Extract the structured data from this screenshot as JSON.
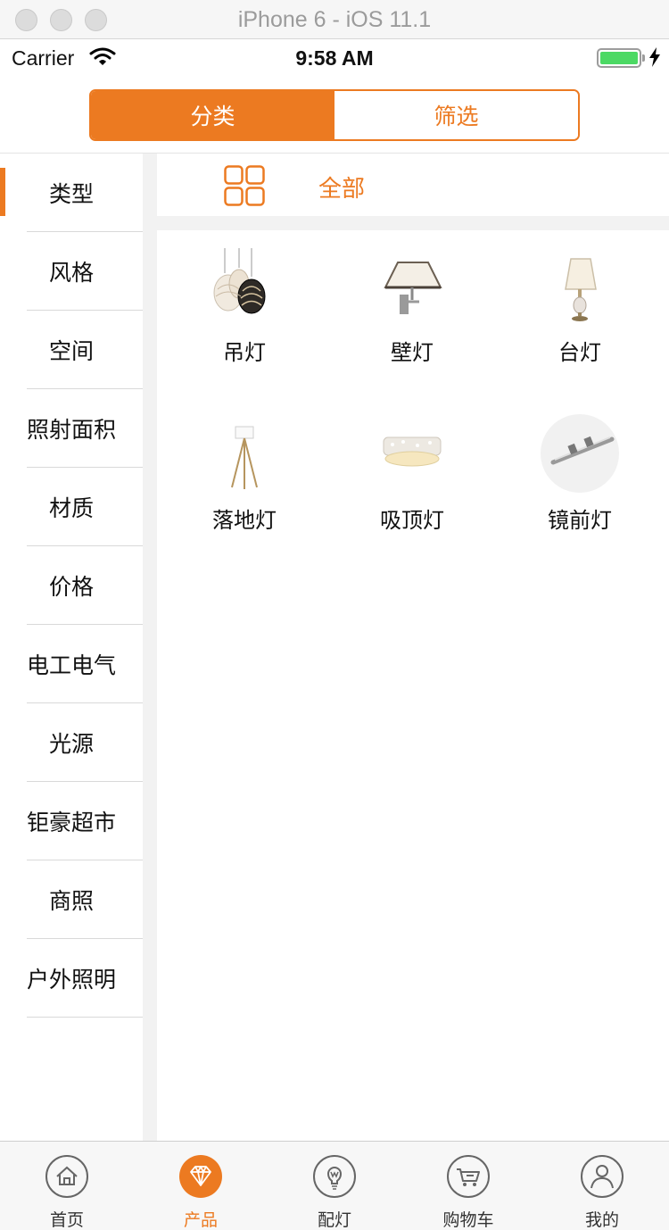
{
  "simulator": {
    "title": "iPhone 6 - iOS 11.1"
  },
  "status_bar": {
    "carrier": "Carrier",
    "time": "9:58 AM"
  },
  "segment": {
    "tabs": [
      {
        "label": "分类",
        "active": true
      },
      {
        "label": "筛选",
        "active": false
      }
    ]
  },
  "sidebar": {
    "items": [
      {
        "label": "类型",
        "selected": true
      },
      {
        "label": "风格"
      },
      {
        "label": "空间"
      },
      {
        "label": "照射面积"
      },
      {
        "label": "材质"
      },
      {
        "label": "价格"
      },
      {
        "label": "电工电气"
      },
      {
        "label": "光源"
      },
      {
        "label": "钜豪超市"
      },
      {
        "label": "商照"
      },
      {
        "label": "户外照明"
      }
    ]
  },
  "content": {
    "all_label": "全部",
    "categories": [
      {
        "label": "吊灯",
        "icon": "pendant-lamp-icon"
      },
      {
        "label": "壁灯",
        "icon": "wall-lamp-icon"
      },
      {
        "label": "台灯",
        "icon": "table-lamp-icon"
      },
      {
        "label": "落地灯",
        "icon": "floor-lamp-icon"
      },
      {
        "label": "吸顶灯",
        "icon": "ceiling-lamp-icon"
      },
      {
        "label": "镜前灯",
        "icon": "mirror-lamp-icon"
      }
    ]
  },
  "tabbar": {
    "tabs": [
      {
        "label": "首页",
        "icon": "home-icon"
      },
      {
        "label": "产品",
        "icon": "diamond-icon",
        "active": true
      },
      {
        "label": "配灯",
        "icon": "bulb-icon"
      },
      {
        "label": "购物车",
        "icon": "cart-icon"
      },
      {
        "label": "我的",
        "icon": "person-icon"
      }
    ]
  },
  "colors": {
    "accent": "#ec7a21",
    "tabbar_bg": "#f7f7f7",
    "divider": "#d9d9d9"
  }
}
